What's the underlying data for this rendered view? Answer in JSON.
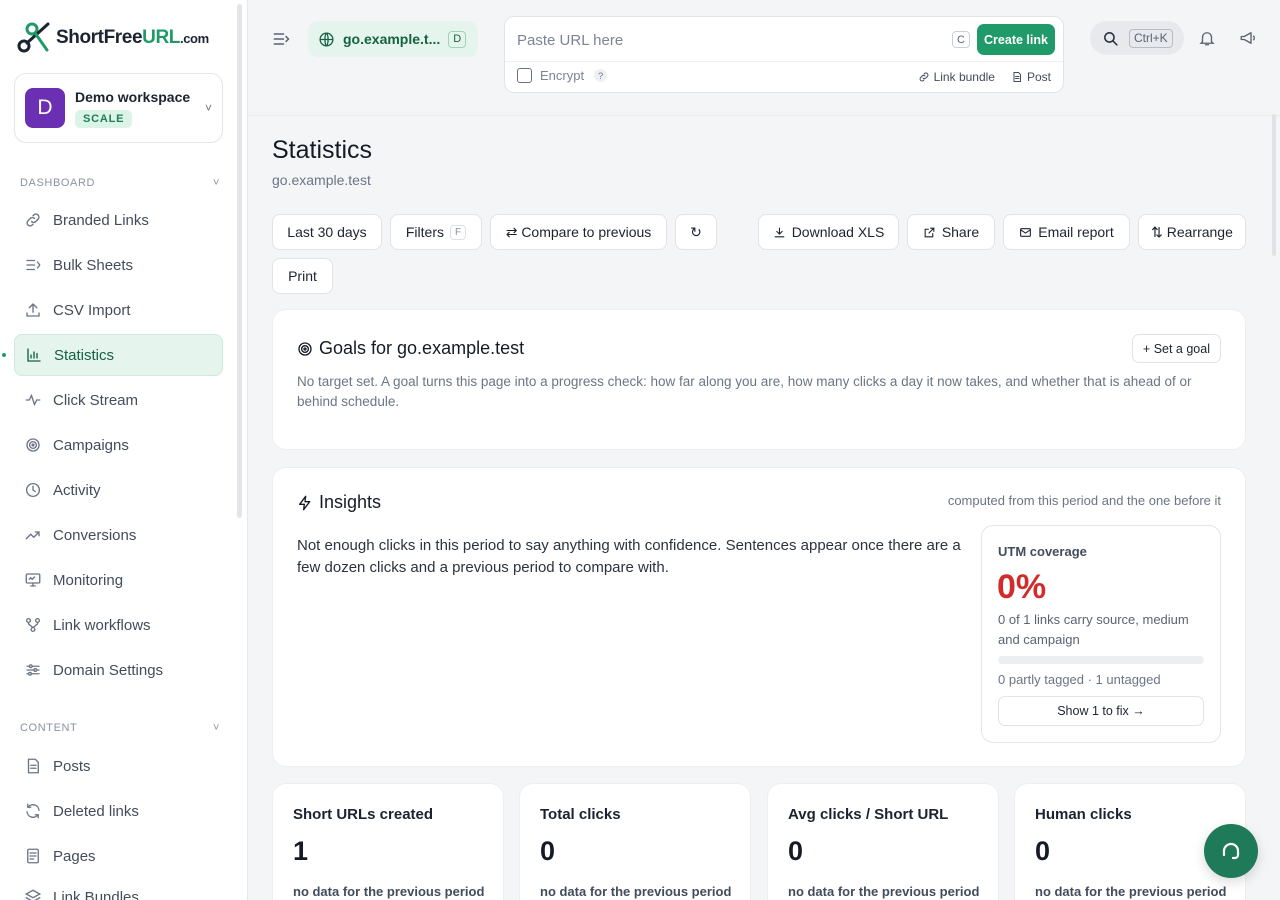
{
  "brand": {
    "name_part1": "ShortFree",
    "name_part2": "URL",
    "name_part3": ".com"
  },
  "workspace": {
    "initial": "D",
    "name": "Demo workspace",
    "plan": "SCALE"
  },
  "sidebar": {
    "dashboard_label": "DASHBOARD",
    "dashboard_items": [
      {
        "label": "Branded Links",
        "icon": "link-icon"
      },
      {
        "label": "Bulk Sheets",
        "icon": "list-icon"
      },
      {
        "label": "CSV Import",
        "icon": "upload-icon"
      },
      {
        "label": "Statistics",
        "icon": "bar-chart-icon",
        "active": true
      },
      {
        "label": "Click Stream",
        "icon": "activity-icon"
      },
      {
        "label": "Campaigns",
        "icon": "target-icon"
      },
      {
        "label": "Activity",
        "icon": "clock-icon"
      },
      {
        "label": "Conversions",
        "icon": "trend-icon"
      },
      {
        "label": "Monitoring",
        "icon": "monitor-icon"
      },
      {
        "label": "Link workflows",
        "icon": "workflow-icon"
      },
      {
        "label": "Domain Settings",
        "icon": "sliders-icon"
      }
    ],
    "content_label": "CONTENT",
    "content_items": [
      {
        "label": "Posts",
        "icon": "document-icon"
      },
      {
        "label": "Deleted links",
        "icon": "refresh-icon"
      },
      {
        "label": "Pages",
        "icon": "page-icon"
      },
      {
        "label": "Link Bundles",
        "icon": "layers-icon"
      }
    ]
  },
  "topbar": {
    "domain": "go.example.t...",
    "domain_shortcut": "D",
    "url_placeholder": "Paste URL here",
    "url_shortcut": "C",
    "create_label": "Create link",
    "encrypt_label": "Encrypt",
    "help_mark": "?",
    "link_bundle_label": "Link bundle",
    "post_label": "Post",
    "search_shortcut": "Ctrl+K"
  },
  "page": {
    "title": "Statistics",
    "subtitle": "go.example.test"
  },
  "toolbar": {
    "range_label": "Last 30 days",
    "filters_label": "Filters",
    "filters_shortcut": "F",
    "compare_label": "⇄ Compare to previous",
    "refresh_glyph": "↻",
    "download_label": "Download XLS",
    "share_label": "Share",
    "email_label": "Email report",
    "rearrange_label": "⇅ Rearrange",
    "print_label": "Print"
  },
  "goals": {
    "title": "Goals for go.example.test",
    "set_goal_label": "+ Set a goal",
    "description": "No target set. A goal turns this page into a progress check: how far along you are, how many clicks a day it now takes, and whether that is ahead of or behind schedule."
  },
  "insights": {
    "title": "Insights",
    "note": "computed from this period and the one before it",
    "text": "Not enough clicks in this period to say anything with confidence. Sentences appear once there are a few dozen clicks and a previous period to compare with.",
    "utm": {
      "title": "UTM coverage",
      "percent": "0%",
      "coverage_fraction": 0,
      "description": "0 of 1 links carry source, medium and campaign",
      "meta": "0 partly tagged · 1 untagged",
      "fix_label": "Show 1 to fix →"
    }
  },
  "stats": [
    {
      "title": "Short URLs created",
      "value": "1",
      "note": "no data for the previous period"
    },
    {
      "title": "Total clicks",
      "value": "0",
      "note": "no data for the previous period"
    },
    {
      "title": "Avg clicks / Short URL",
      "value": "0",
      "note": "no data for the previous period"
    },
    {
      "title": "Human clicks",
      "value": "0",
      "note": "no data for the previous period"
    }
  ],
  "colors": {
    "accent": "#1f9a68",
    "danger": "#d12b2b",
    "workspace_avatar": "#6b2fb3"
  }
}
